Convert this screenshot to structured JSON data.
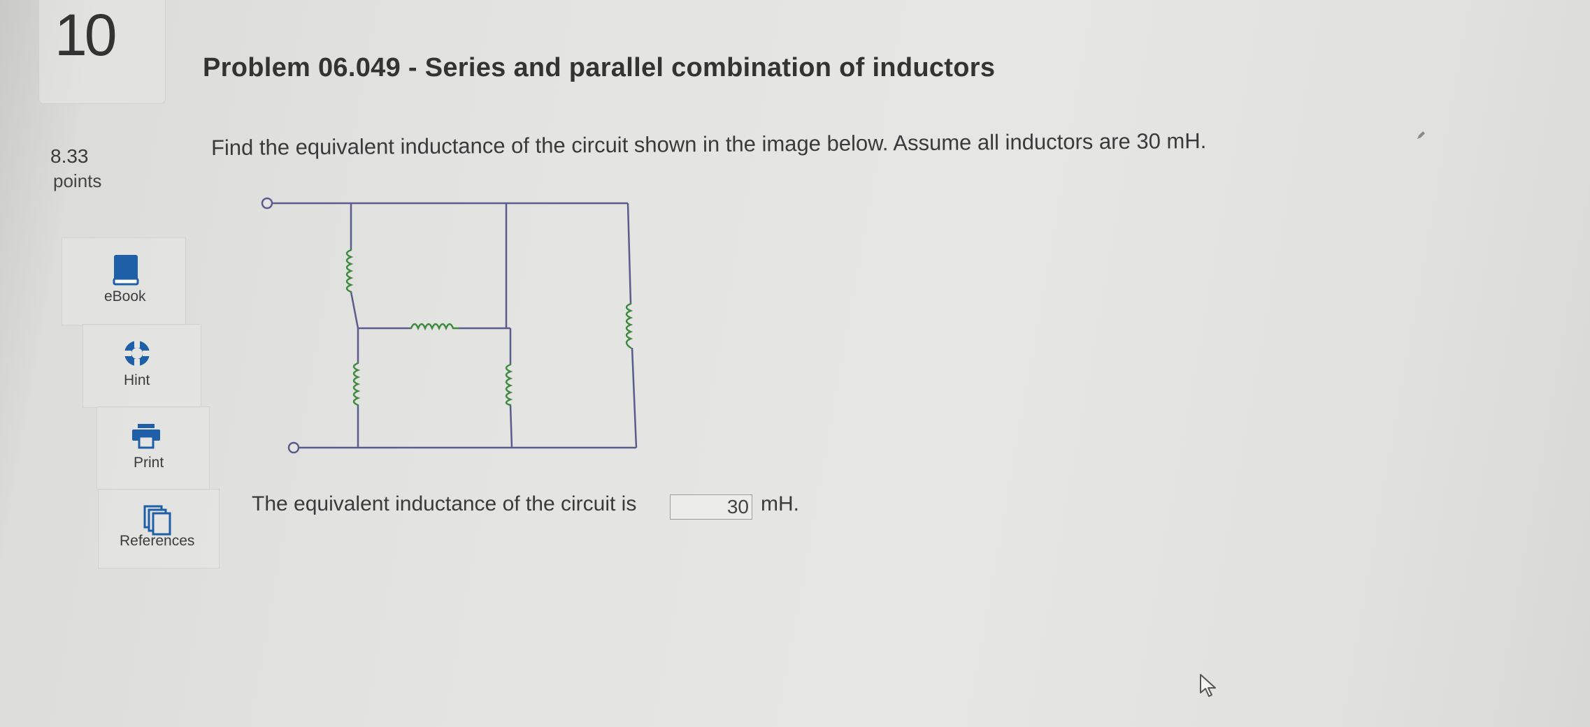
{
  "question": {
    "number": "10",
    "title": "Problem 06.049 - Series and parallel combination of inductors",
    "points_value": "8.33",
    "points_label": "points",
    "prompt": "Find the equivalent inductance of the circuit shown in the image below. Assume all inductors are 30 mH."
  },
  "tools": [
    {
      "label": "eBook",
      "icon": "book-icon"
    },
    {
      "label": "Hint",
      "icon": "lifebuoy-icon"
    },
    {
      "label": "Print",
      "icon": "printer-icon"
    },
    {
      "label": "References",
      "icon": "documents-icon"
    }
  ],
  "answer": {
    "prefix": "The equivalent inductance of the circuit is",
    "value": "30",
    "unit": "mH."
  },
  "colors": {
    "wire": "#5a5c8c",
    "inductor": "#3f8a40",
    "icon_blue": "#1f5fa8"
  }
}
